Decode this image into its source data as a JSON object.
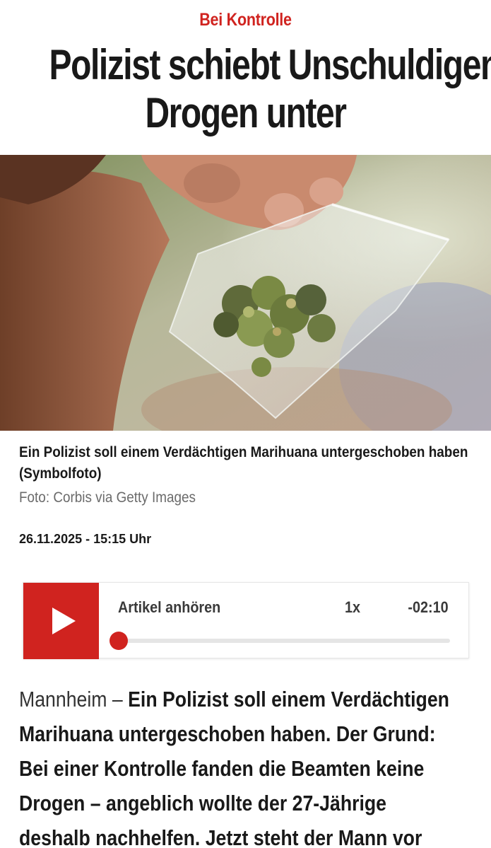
{
  "article": {
    "kicker": "Bei Kontrolle",
    "headline_line1": "Polizist schiebt Unschuldigem",
    "headline_line2": "Drogen unter",
    "image_caption": "Ein Polizist soll einem Verdächtigen Marihuana untergeschoben haben (Symbolfoto)",
    "image_credit": "Foto: Corbis via Getty Images",
    "date": "26.11.2025 - 15:15 Uhr",
    "body_place": "Mannheim – ",
    "body_lead": "Ein Polizist soll einem Verdächtigen Marihuana untergeschoben haben. Der Grund: Bei einer Kontrolle fanden die Beamten keine Drogen – angeblich wollte der 27-Jährige deshalb nachhelfen. Jetzt steht der Mann vor"
  },
  "audio_player": {
    "label": "Artikel anhören",
    "speed": "1x",
    "time_remaining": "-02:10",
    "progress": 0,
    "accent_color": "#d0231f",
    "play_icon": "play-icon"
  },
  "colors": {
    "kicker": "#d0231f",
    "headline": "#191919",
    "credit": "#6b6b6b"
  }
}
